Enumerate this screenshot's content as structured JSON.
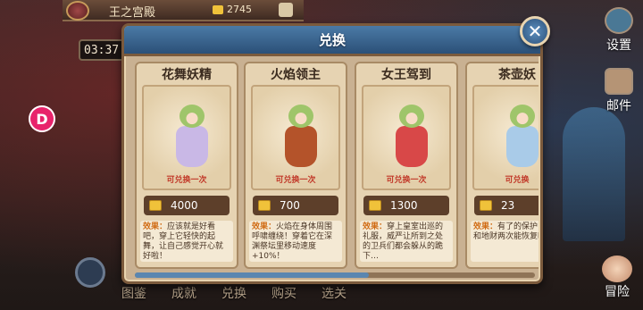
{
  "hud": {
    "palace_title": "王之宫殿",
    "currency_amount": "2745",
    "timer": "03:37",
    "fab_letter": "D"
  },
  "right_menu": {
    "settings": "设置",
    "mail": "邮件",
    "adventure": "冒险"
  },
  "bottom_nav": [
    "图鉴",
    "成就",
    "兑换",
    "购买",
    "选关"
  ],
  "modal": {
    "title": "兑换",
    "close": "✕",
    "cards": [
      {
        "name": "花舞妖精",
        "once": "可兑换一次",
        "price": "4000",
        "tag": "效果：",
        "desc": "应该就是好看吧，穿上它轻快的起舞，让自己感觉开心就好啦！",
        "body_color": "#c9b8e6"
      },
      {
        "name": "火焰领主",
        "once": "可兑换一次",
        "price": "700",
        "tag": "效果：",
        "desc": "火焰在身体周围呼啸缠绕！穿着它在深渊祭坛里移动速度+10%！",
        "body_color": "#b4532a"
      },
      {
        "name": "女王驾到",
        "once": "可兑换一次",
        "price": "1300",
        "tag": "效果：",
        "desc": "穿上皇室出巡的礼服，威严让所到之处的卫兵们都会躲从的跪下…",
        "body_color": "#d84848"
      },
      {
        "name": "茶壶妖",
        "once": "可兑换",
        "price": "23",
        "tag": "效果：",
        "desc": "有了的保护，能和地财两次能恢复哦",
        "body_color": "#a9cbe8"
      }
    ]
  },
  "colors": {
    "header_blue": "#2b5078",
    "gold": "#f0c23a",
    "tag_orange": "#d06a12"
  }
}
